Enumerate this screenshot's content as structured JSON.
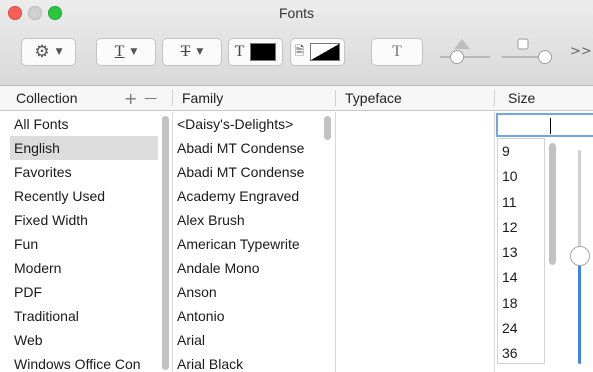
{
  "window": {
    "title": "Fonts"
  },
  "toolbar": {
    "action_button": "gear-icon",
    "underline_label": "T",
    "strike_label": "T",
    "text_color_label": "T",
    "text_color": "#000000",
    "doc_color_label": "D",
    "shadow_label": "T",
    "more_label": ">>"
  },
  "headers": {
    "collection": "Collection",
    "add": "+",
    "remove": "—",
    "family": "Family",
    "typeface": "Typeface",
    "size": "Size"
  },
  "collections": [
    "All Fonts",
    "English",
    "Favorites",
    "Recently Used",
    "Fixed Width",
    "Fun",
    "Modern",
    "PDF",
    "Traditional",
    "Web",
    "Windows Office Con"
  ],
  "selected_collection": "English",
  "families": [
    "<Daisy's-Delights>",
    "Abadi MT Condense",
    "Abadi MT Condense",
    "Academy Engraved",
    "Alex Brush",
    "American Typewrite",
    "Andale Mono",
    "Anson",
    "Antonio",
    "Arial",
    "Arial Black"
  ],
  "size": {
    "input_value": "",
    "options": [
      "9",
      "10",
      "11",
      "12",
      "13",
      "14",
      "18",
      "24",
      "36"
    ]
  }
}
